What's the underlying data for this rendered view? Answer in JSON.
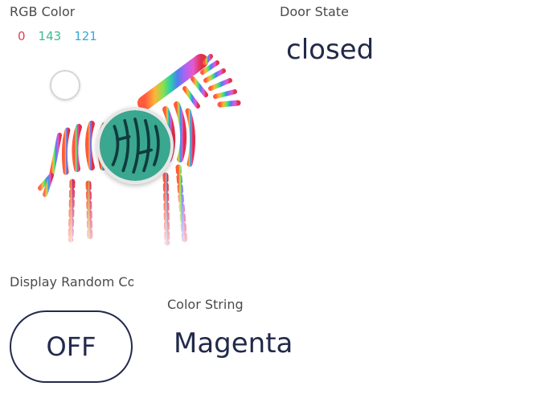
{
  "rgb_widget": {
    "label": "RGB Color",
    "r": "0",
    "g": "143",
    "b": "121",
    "colors": {
      "r": "#e04057",
      "g": "#3dbb8c",
      "b": "#38a9d9",
      "selected": "#008f79"
    }
  },
  "door_widget": {
    "label": "Door State",
    "value": "closed"
  },
  "random_widget": {
    "label": "Display Random Color",
    "button_label": "OFF"
  },
  "string_widget": {
    "label": "Color String",
    "value": "Magenta"
  },
  "icons": {
    "zebra": "zebra-color-wheel-icon"
  }
}
